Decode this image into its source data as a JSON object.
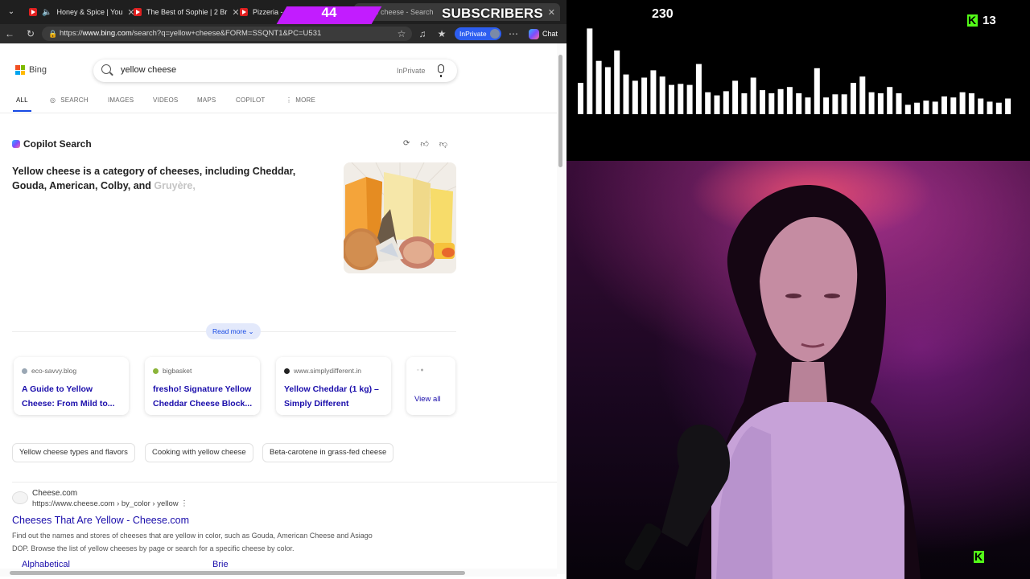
{
  "tabs": [
    {
      "title": "Honey & Spice | You",
      "icon": "youtube-icon"
    },
    {
      "title": "The Best of Sophie | 2 Br",
      "icon": "youtube-icon"
    },
    {
      "title": "Pizzeria - Piekar",
      "icon": "youtube-icon"
    },
    {
      "title": "w cheese - Search",
      "icon": "bing-icon"
    }
  ],
  "toolbar": {
    "url_prefix": "https://",
    "url_domain": "www.bing.com",
    "url_path": "/search?q=yellow+cheese&FORM=SSQNT1&PC=U531",
    "inprivate_label": "InPrivate",
    "chat_label": "Chat"
  },
  "bing": {
    "logo_text": "Bing",
    "query": "yellow cheese",
    "inprivate_hint": "InPrivate",
    "scopes": [
      "ALL",
      "SEARCH",
      "IMAGES",
      "VIDEOS",
      "MAPS",
      "COPILOT",
      "MORE"
    ]
  },
  "copilot": {
    "header": "Copilot Search",
    "answer_bold": "Yellow cheese is a category of cheeses, including Cheddar, Gouda, American, Colby, and ",
    "answer_fade": "Gruyère,",
    "read_more": "Read more"
  },
  "sources": [
    {
      "domain": "eco-savvy.blog",
      "title": "A Guide to Yellow Cheese: From Mild to...",
      "dot": "#9aa7b4"
    },
    {
      "domain": "bigbasket",
      "title": "fresho! Signature Yellow Cheddar Cheese Block...",
      "dot": "#8bb43a"
    },
    {
      "domain": "www.simplydifferent.in",
      "title": "Yellow Cheddar (1 kg) – Simply Different",
      "dot": "#222222"
    }
  ],
  "view_all": "View all",
  "chips": [
    "Yellow cheese types and flavors",
    "Cooking with yellow cheese",
    "Beta-carotene in grass-fed cheese"
  ],
  "result": {
    "site": "Cheese.com",
    "url": "https://www.cheese.com › by_color › yellow ⋮",
    "title": "Cheeses That Are Yellow - Cheese.com",
    "desc": "Find out the names and stores of cheeses that are yellow in color, such as Gouda, American Cheese and Asiago DOP. Browse the list of yellow cheeses by page or search for a specific cheese by color.",
    "links": [
      "Alphabetical",
      "Brie"
    ]
  },
  "overlay": {
    "subscribers_count": "44",
    "subscribers_label": "SUBSCRIBERS",
    "viewer_count": "230",
    "kick_viewers": "13"
  },
  "visualizer_levels": [
    0.3,
    0.82,
    0.51,
    0.45,
    0.61,
    0.38,
    0.32,
    0.35,
    0.42,
    0.36,
    0.28,
    0.29,
    0.28,
    0.48,
    0.21,
    0.18,
    0.22,
    0.32,
    0.2,
    0.35,
    0.23,
    0.2,
    0.24,
    0.26,
    0.2,
    0.16,
    0.44,
    0.16,
    0.19,
    0.19,
    0.3,
    0.36,
    0.21,
    0.2,
    0.26,
    0.2,
    0.09,
    0.11,
    0.13,
    0.12,
    0.17,
    0.16,
    0.21,
    0.2,
    0.15,
    0.12,
    0.11,
    0.15
  ]
}
